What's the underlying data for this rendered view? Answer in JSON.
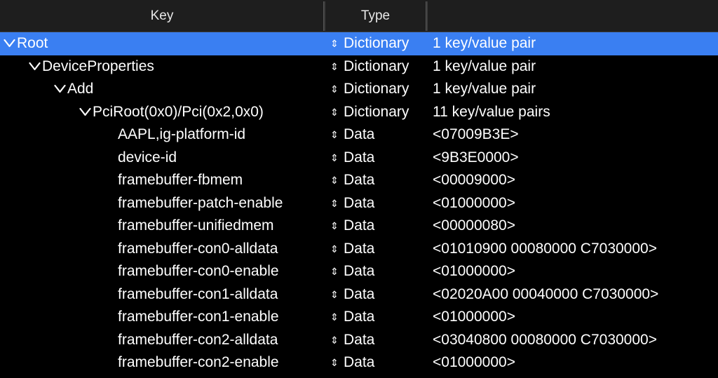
{
  "header": {
    "key_label": "Key",
    "type_label": "Type",
    "value_label": ""
  },
  "rows": [
    {
      "key": "Root",
      "type": "Dictionary",
      "value": "1 key/value pair",
      "level": 0,
      "expandable": true,
      "selected": true
    },
    {
      "key": "DeviceProperties",
      "type": "Dictionary",
      "value": "1 key/value pair",
      "level": 1,
      "expandable": true,
      "selected": false
    },
    {
      "key": "Add",
      "type": "Dictionary",
      "value": "1 key/value pair",
      "level": 2,
      "expandable": true,
      "selected": false
    },
    {
      "key": "PciRoot(0x0)/Pci(0x2,0x0)",
      "type": "Dictionary",
      "value": "11 key/value pairs",
      "level": 3,
      "expandable": true,
      "selected": false
    },
    {
      "key": "AAPL,ig-platform-id",
      "type": "Data",
      "value": "<07009B3E>",
      "level": 4,
      "expandable": false,
      "selected": false
    },
    {
      "key": "device-id",
      "type": "Data",
      "value": "<9B3E0000>",
      "level": 4,
      "expandable": false,
      "selected": false
    },
    {
      "key": "framebuffer-fbmem",
      "type": "Data",
      "value": "<00009000>",
      "level": 4,
      "expandable": false,
      "selected": false
    },
    {
      "key": "framebuffer-patch-enable",
      "type": "Data",
      "value": "<01000000>",
      "level": 4,
      "expandable": false,
      "selected": false
    },
    {
      "key": "framebuffer-unifiedmem",
      "type": "Data",
      "value": "<00000080>",
      "level": 4,
      "expandable": false,
      "selected": false
    },
    {
      "key": "framebuffer-con0-alldata",
      "type": "Data",
      "value": "<01010900 00080000 C7030000>",
      "level": 4,
      "expandable": false,
      "selected": false
    },
    {
      "key": "framebuffer-con0-enable",
      "type": "Data",
      "value": "<01000000>",
      "level": 4,
      "expandable": false,
      "selected": false
    },
    {
      "key": "framebuffer-con1-alldata",
      "type": "Data",
      "value": "<02020A00 00040000 C7030000>",
      "level": 4,
      "expandable": false,
      "selected": false
    },
    {
      "key": "framebuffer-con1-enable",
      "type": "Data",
      "value": "<01000000>",
      "level": 4,
      "expandable": false,
      "selected": false
    },
    {
      "key": "framebuffer-con2-alldata",
      "type": "Data",
      "value": "<03040800 00080000 C7030000>",
      "level": 4,
      "expandable": false,
      "selected": false
    },
    {
      "key": "framebuffer-con2-enable",
      "type": "Data",
      "value": "<01000000>",
      "level": 4,
      "expandable": false,
      "selected": false
    }
  ],
  "icons": {
    "disclosure": "chevron-down-icon",
    "type_stepper": "up-down-stepper-icon"
  },
  "colors": {
    "selection": "#3a7ff2",
    "background": "#000000",
    "header": "#1e1e1e",
    "text": "#ffffff"
  }
}
